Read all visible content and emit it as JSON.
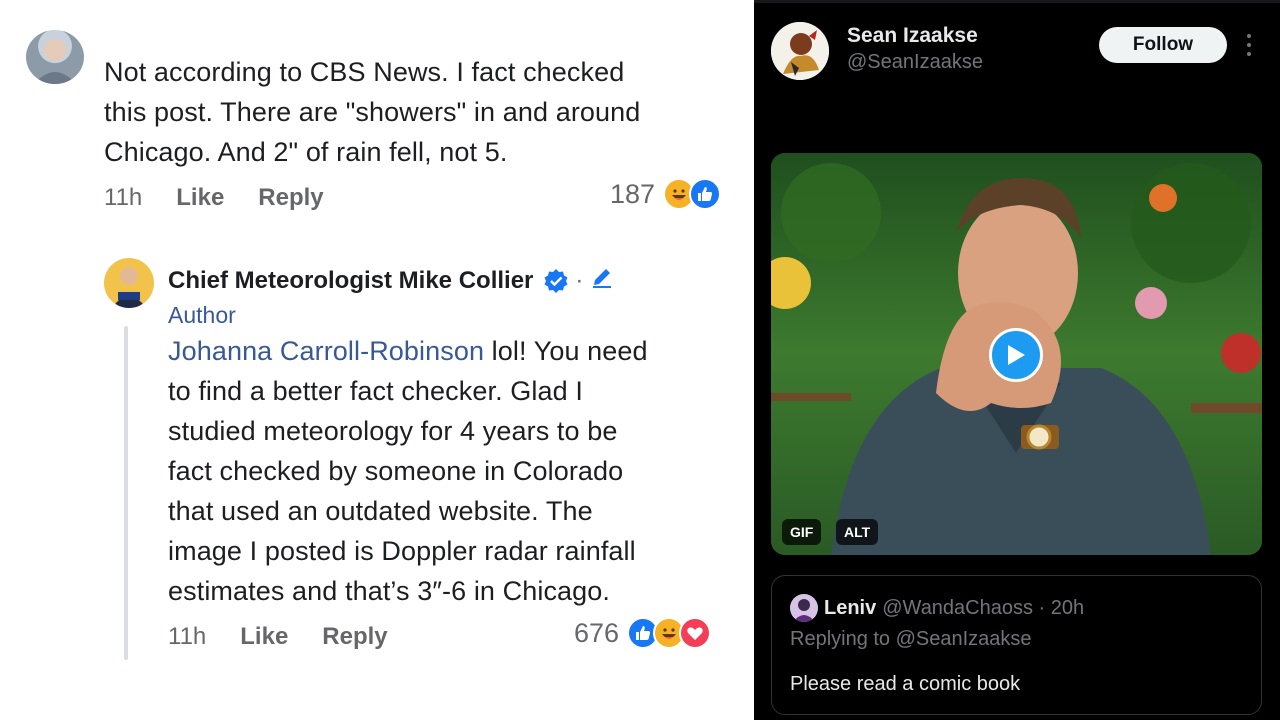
{
  "facebook": {
    "comment1": {
      "lines": [
        "Not according to CBS News. I fact checked",
        "this post. There are \"showers\" in and around",
        "Chicago. And 2\" of rain fell, not 5."
      ],
      "time": "11h",
      "like_label": "Like",
      "reply_label": "Reply",
      "reaction_count": "187",
      "reactions": [
        "haha",
        "like"
      ]
    },
    "reply": {
      "author_name": "Chief Meteorologist Mike Collier",
      "badge": "Author",
      "mention": "Johanna Carroll-Robinson",
      "first_line_rest": " lol! You need",
      "lines": [
        "to find a better fact checker. Glad I",
        "studied meteorology for 4 years to be",
        "fact checked by someone in Colorado",
        "that used an outdated website. The",
        "image I posted is Doppler radar rainfall",
        "estimates and that’s 3″-6 in Chicago."
      ],
      "time": "11h",
      "like_label": "Like",
      "reply_label": "Reply",
      "reaction_count": "676",
      "reactions": [
        "like",
        "haha",
        "love"
      ]
    }
  },
  "twitter": {
    "display_name": "Sean Izaakse",
    "handle": "@SeanIzaakse",
    "follow_label": "Follow",
    "media_badges": [
      "GIF",
      "ALT"
    ],
    "quote": {
      "name": "Leniv",
      "handle_time": "@WandaChaoss · 20h",
      "replying_to": "Replying to @SeanIzaakse",
      "text": "Please read a comic book"
    }
  },
  "colors": {
    "fb_blue": "#1877f2",
    "fb_link": "#385898",
    "tw_blue": "#1d9bf0",
    "tw_bg": "#000000"
  }
}
